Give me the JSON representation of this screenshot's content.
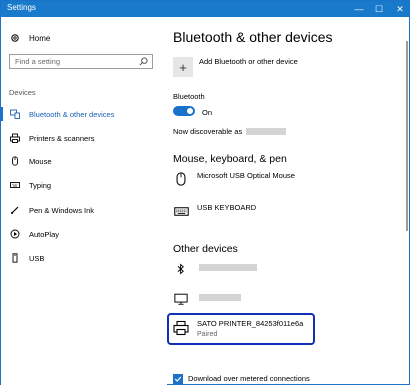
{
  "window": {
    "title": "Settings",
    "minimize": "—",
    "maximize": "☐",
    "close": "✕"
  },
  "sidebar": {
    "home": "Home",
    "search_placeholder": "Find a setting",
    "section": "Devices",
    "items": [
      {
        "label": "Bluetooth & other devices",
        "icon": "bluetooth-devices-icon",
        "active": true
      },
      {
        "label": "Printers & scanners",
        "icon": "printer-icon",
        "active": false
      },
      {
        "label": "Mouse",
        "icon": "mouse-icon",
        "active": false
      },
      {
        "label": "Typing",
        "icon": "keyboard-icon",
        "active": false
      },
      {
        "label": "Pen & Windows Ink",
        "icon": "pen-icon",
        "active": false
      },
      {
        "label": "AutoPlay",
        "icon": "autoplay-icon",
        "active": false
      },
      {
        "label": "USB",
        "icon": "usb-icon",
        "active": false
      }
    ]
  },
  "main": {
    "title": "Bluetooth & other devices",
    "add_device": "Add Bluetooth or other device",
    "bluetooth_label": "Bluetooth",
    "bluetooth_state": "On",
    "discoverable": "Now discoverable as",
    "mkp_heading": "Mouse, keyboard, & pen",
    "mkp_devices": [
      {
        "name": "Microsoft USB Optical Mouse",
        "icon": "mouse-icon"
      },
      {
        "name": "USB KEYBOARD",
        "icon": "keyboard-icon"
      }
    ],
    "other_heading": "Other devices",
    "other_devices": [
      {
        "name": "SATO PRINTER_84253f011e6a",
        "status": "Paired",
        "icon": "printer-icon"
      }
    ],
    "metered_label": "Download over metered connections"
  },
  "colors": {
    "accent": "#1a73c9",
    "titlebar": "#1979ca",
    "highlight_border": "#1130b8"
  }
}
